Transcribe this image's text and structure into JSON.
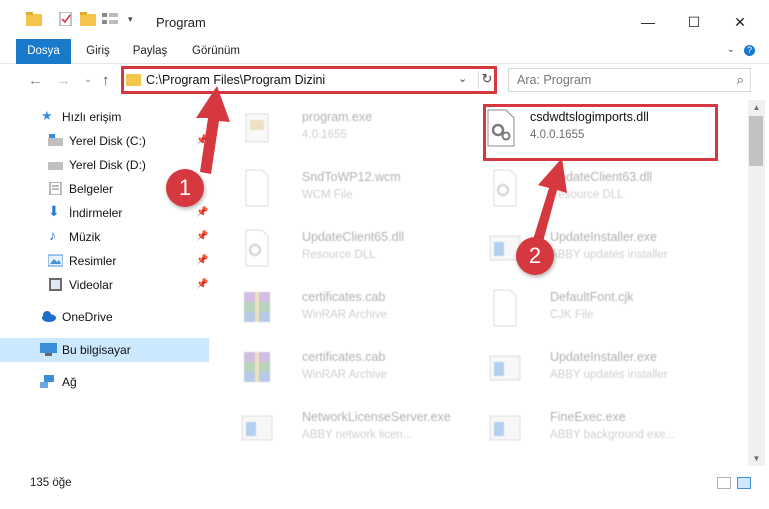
{
  "window": {
    "title": "Program",
    "minimize": "—",
    "maximize": "☐",
    "close": "✕"
  },
  "ribbon": {
    "tabs": [
      "Dosya",
      "Giriş",
      "Paylaş",
      "Görünüm"
    ]
  },
  "nav": {
    "back": "←",
    "forward": "→",
    "recent": "⌄",
    "up": "↑"
  },
  "address": {
    "path": "C:\\Program Files\\Program Dizini",
    "chevron": "⌄",
    "refresh": "↻"
  },
  "search": {
    "placeholder": "Ara: Program",
    "icon": "search-icon"
  },
  "sidebar": {
    "items": [
      {
        "label": "Hızlı erişim",
        "icon": "star-icon"
      },
      {
        "label": "Yerel Disk (C:)",
        "icon": "drive-icon"
      },
      {
        "label": "Yerel Disk (D:)",
        "icon": "drive-icon"
      },
      {
        "label": "Belgeler",
        "icon": "document-icon"
      },
      {
        "label": "İndirmeler",
        "icon": "download-icon"
      },
      {
        "label": "Müzik",
        "icon": "music-icon"
      },
      {
        "label": "Resimler",
        "icon": "pictures-icon"
      },
      {
        "label": "Videolar",
        "icon": "video-icon"
      },
      {
        "label": "OneDrive",
        "icon": "cloud-icon"
      },
      {
        "label": "Bu bilgisayar",
        "icon": "computer-icon"
      },
      {
        "label": "Ağ",
        "icon": "network-icon"
      }
    ]
  },
  "files": [
    {
      "name": "program.exe",
      "sub": "4.0.1655",
      "icon": "exe-icon"
    },
    {
      "name": "csdwdtslogimports.dll",
      "sub": "4.0.0.1655",
      "icon": "dll-icon"
    },
    {
      "name": "SndToWP12.wcm",
      "sub": "WCM File",
      "icon": "blank-file-icon"
    },
    {
      "name": "UpdateClient63.dll",
      "sub": "Resource DLL",
      "icon": "dll-icon"
    },
    {
      "name": "UpdateClient65.dll",
      "sub": "Resource DLL",
      "icon": "dll-icon"
    },
    {
      "name": "UpdateInstaller.exe",
      "sub": "ABBY updates installer",
      "icon": "exe-icon"
    },
    {
      "name": "certificates.cab",
      "sub": "WinRAR Archive",
      "icon": "archive-icon"
    },
    {
      "name": "DefaultFont.cjk",
      "sub": "CJK File",
      "icon": "blank-file-icon"
    },
    {
      "name": "certificates.cab",
      "sub": "WinRAR Archive",
      "icon": "archive-icon"
    },
    {
      "name": "UpdateInstaller.exe",
      "sub": "ABBY updates installer",
      "icon": "exe-icon"
    },
    {
      "name": "NetworkLicenseServer.exe",
      "sub": "ABBY network licen...",
      "icon": "exe-icon"
    },
    {
      "name": "FineExec.exe",
      "sub": "ABBY background exe...",
      "icon": "exe-icon"
    }
  ],
  "status": {
    "count": "135 öğe"
  },
  "callouts": {
    "one": "1",
    "two": "2"
  },
  "colors": {
    "accent": "#1979ca",
    "highlight": "#d6383f",
    "selected": "#cce8ff"
  }
}
